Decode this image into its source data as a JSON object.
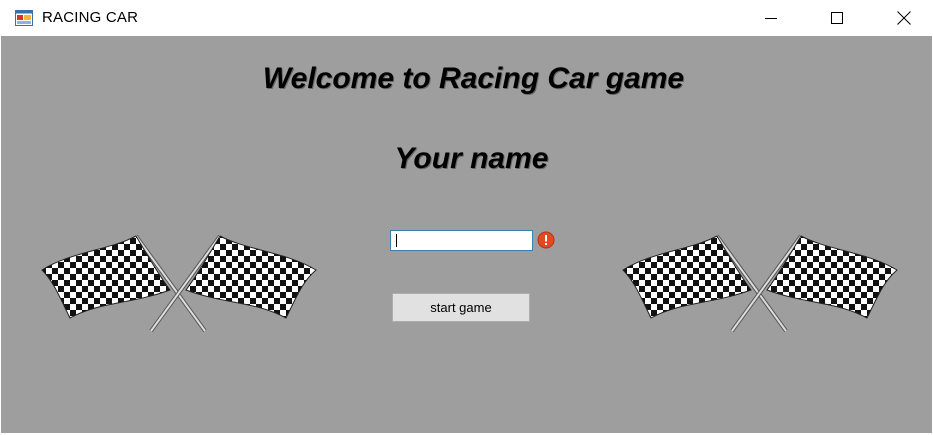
{
  "window": {
    "title": "RACING CAR",
    "icon": "app-window-icon",
    "controls": {
      "minimize_icon": "minimize-icon",
      "maximize_icon": "maximize-icon",
      "close_icon": "close-icon"
    }
  },
  "main": {
    "welcome_text": "Welcome to Racing Car game",
    "prompt_text": "Your name",
    "name_input": {
      "value": "",
      "error_icon": "error-icon"
    },
    "start_button_label": "start game",
    "decorations": [
      "checkered-flags-left",
      "checkered-flags-right"
    ]
  },
  "colors": {
    "background": "#9e9e9e",
    "button": "#e1e1e1",
    "input_border": "#3c7fb1",
    "error": "#e24a23"
  }
}
